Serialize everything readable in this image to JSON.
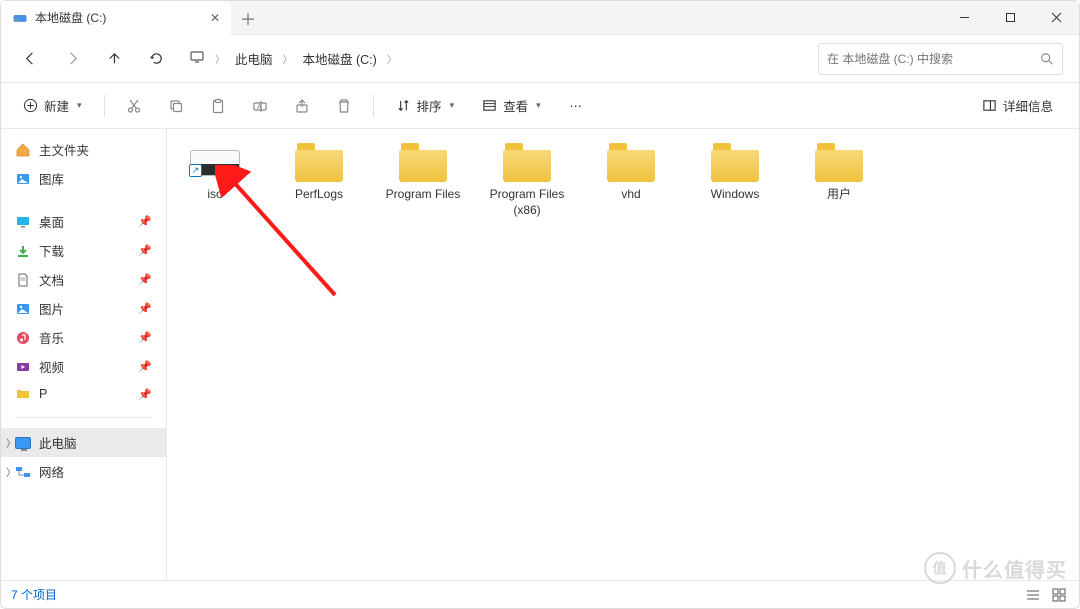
{
  "tab": {
    "title": "本地磁盘 (C:)"
  },
  "breadcrumb": {
    "item1": "此电脑",
    "item2": "本地磁盘 (C:)"
  },
  "search": {
    "placeholder": "在 本地磁盘 (C:) 中搜索"
  },
  "toolbar": {
    "new_label": "新建",
    "sort_label": "排序",
    "view_label": "查看",
    "details_label": "详细信息"
  },
  "sidebar": {
    "home": "主文件夹",
    "gallery": "图库",
    "desktop": "桌面",
    "downloads": "下载",
    "documents": "文档",
    "pictures": "图片",
    "music": "音乐",
    "videos": "视频",
    "p_folder": "P",
    "this_pc": "此电脑",
    "network": "网络"
  },
  "items": [
    {
      "name": "iso",
      "type": "drive-shortcut"
    },
    {
      "name": "PerfLogs",
      "type": "folder"
    },
    {
      "name": "Program Files",
      "type": "folder"
    },
    {
      "name": "Program Files (x86)",
      "type": "folder"
    },
    {
      "name": "vhd",
      "type": "folder"
    },
    {
      "name": "Windows",
      "type": "folder"
    },
    {
      "name": "用户",
      "type": "folder"
    }
  ],
  "status": {
    "count": "7 个项目"
  },
  "watermark": {
    "text": "什么值得买",
    "icon": "值"
  }
}
